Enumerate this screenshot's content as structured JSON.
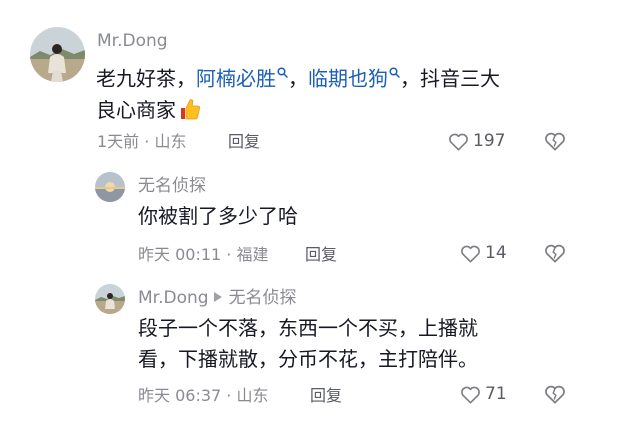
{
  "comments": [
    {
      "username": "Mr.Dong",
      "text_1": "老九好茶，",
      "mention_1": "阿楠必胜",
      "text_2": "，",
      "mention_2": "临期也狗",
      "text_3": "，抖音三大",
      "text_4": "良心商家",
      "emoji": "thumbs-up-icon",
      "meta": "1天前 · 山东",
      "reply_label": "回复",
      "like_count": "197"
    }
  ],
  "replies": [
    {
      "username": "无名侦探",
      "text": "你被割了多少了哈",
      "meta": "昨天 00:11 · 福建",
      "reply_label": "回复",
      "like_count": "14"
    },
    {
      "username": "Mr.Dong",
      "reply_to": "无名侦探",
      "text_line_1": "段子一个不落，东西一个不买，上播就",
      "text_line_2": "看，下播就散，分币不花，主打陪伴。",
      "meta": "昨天 06:37 · 山东",
      "reply_label": "回复",
      "like_count": "71"
    }
  ],
  "colors": {
    "mention": "#1b5fb7",
    "meta": "#8a8b91",
    "text": "#161823"
  }
}
